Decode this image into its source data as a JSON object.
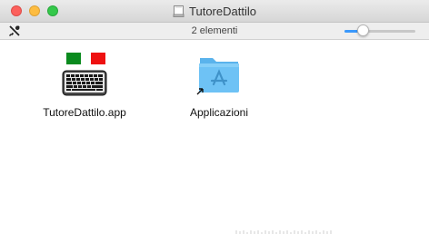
{
  "window": {
    "title": "TutoreDattilo",
    "disk_icon": "disk-image-icon"
  },
  "toolbar": {
    "item_count": "2 elementi",
    "tools_icon": "tools-icon",
    "icon_size_slider": 0.22
  },
  "items": [
    {
      "label": "TutoreDattilo.app",
      "icon": "keyboard-app-icon"
    },
    {
      "label": "Applicazioni",
      "icon": "applications-folder-alias-icon"
    }
  ],
  "colors": {
    "close": "#fc605c",
    "minimize": "#fdbc40",
    "maximize": "#34c84a",
    "accent": "#3b99fc",
    "folder": "#6ec2f5",
    "flag_green": "#0a8a1e",
    "flag_red": "#ee1111"
  }
}
